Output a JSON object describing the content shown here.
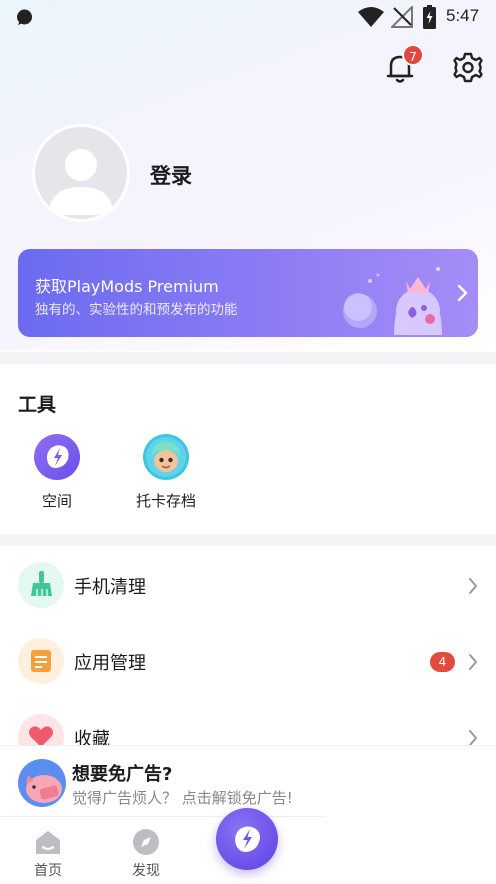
{
  "status_bar": {
    "time": "5:47",
    "icons": [
      "message-icon",
      "wifi-icon",
      "no-signal-icon",
      "battery-charging-icon"
    ]
  },
  "header": {
    "notification_count": "7",
    "icons": [
      "bell-icon",
      "gear-icon"
    ]
  },
  "profile": {
    "login_label": "登录"
  },
  "premium": {
    "title": "获取PlayMods Premium",
    "subtitle": "独有的、实验性的和预发布的功能"
  },
  "tools": {
    "title": "工具",
    "items": [
      {
        "label": "空间",
        "icon": "space-icon"
      },
      {
        "label": "托卡存档",
        "icon": "toca-save-icon"
      }
    ]
  },
  "menu": {
    "items": [
      {
        "label": "手机清理",
        "icon": "broom-icon",
        "badge": ""
      },
      {
        "label": "应用管理",
        "icon": "app-manage-icon",
        "badge": "4"
      },
      {
        "label": "收藏",
        "icon": "heart-icon",
        "badge": ""
      }
    ]
  },
  "ad": {
    "title": "想要免广告?",
    "subtitle": "觉得广告烦人？ 点击解锁免广告!"
  },
  "bottom_nav": {
    "items": [
      {
        "label": "首页",
        "icon": "home-icon"
      },
      {
        "label": "发现",
        "icon": "compass-icon"
      }
    ],
    "center_icon": "playmods-logo-icon"
  },
  "colors": {
    "accent": "#6b5cf0",
    "badge_red": "#e5463e"
  }
}
